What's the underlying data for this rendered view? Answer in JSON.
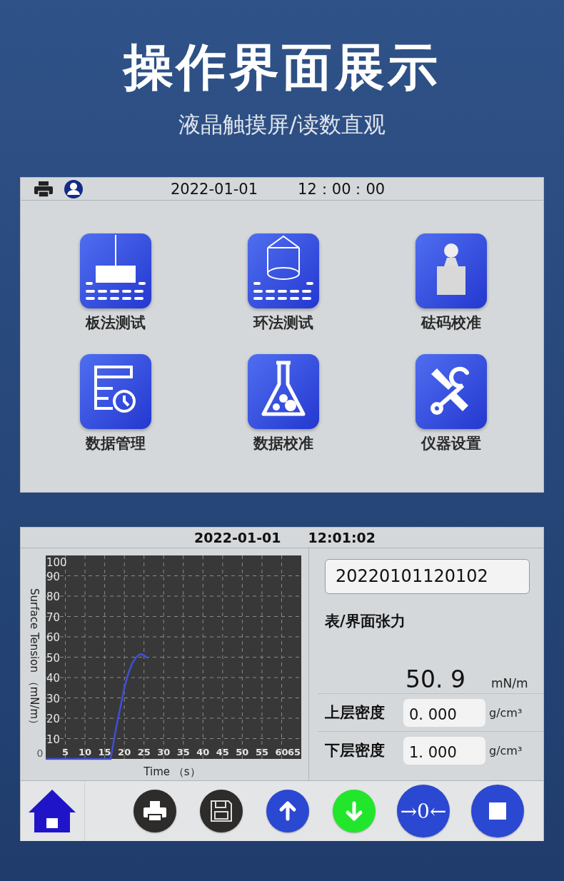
{
  "title": "操作界面展示",
  "subtitle": "液晶触摸屏/读数直观",
  "main_menu": {
    "status_bar": {
      "date": "2022-01-01",
      "time": "12：00：00"
    },
    "tiles": [
      {
        "kind": "plate",
        "label": "板法测试"
      },
      {
        "kind": "ring",
        "label": "环法测试"
      },
      {
        "kind": "weight",
        "label": "砝码校准"
      },
      {
        "kind": "records",
        "label": "数据管理"
      },
      {
        "kind": "flask",
        "label": "数据校准"
      },
      {
        "kind": "tools",
        "label": "仪器设置"
      }
    ]
  },
  "test_screen": {
    "header": {
      "date": "2022-01-01",
      "time": "12:01:02"
    },
    "chart_data": {
      "type": "line",
      "grid": true,
      "xlabel": "Time （s）",
      "ylabel": "Surface Tension （mN/m）",
      "xlim": [
        0,
        65
      ],
      "ylim": [
        0,
        100
      ],
      "xticks": [
        0,
        5,
        10,
        15,
        20,
        25,
        30,
        35,
        40,
        45,
        50,
        55,
        60,
        65
      ],
      "yticks": [
        10,
        20,
        30,
        40,
        50,
        60,
        70,
        80,
        90,
        100
      ],
      "x": [
        0,
        16.5,
        18,
        20,
        21,
        22,
        23,
        24,
        25,
        26
      ],
      "series": [
        {
          "color": "#3f4fd6",
          "values": [
            0,
            0,
            16,
            35,
            42,
            47,
            50,
            51.5,
            51,
            49.5
          ]
        }
      ]
    },
    "sample_id": "20220101120102",
    "result": {
      "label": "表/界面张力",
      "value": "50. 9",
      "unit": "mN/m"
    },
    "densities": [
      {
        "label": "上层密度",
        "value": "0. 000",
        "unit": "g/cm³"
      },
      {
        "label": "下层密度",
        "value": "1. 000",
        "unit": "g/cm³"
      }
    ],
    "toolbar": [
      {
        "kind": "home"
      },
      {
        "kind": "print",
        "color": "#2e2b2b"
      },
      {
        "kind": "save",
        "color": "#2e2b2b"
      },
      {
        "kind": "up",
        "color": "#2b48d2"
      },
      {
        "kind": "down",
        "color": "#22e62c"
      },
      {
        "kind": "zero",
        "color": "#2b48d2",
        "label": "→0←"
      },
      {
        "kind": "stop",
        "color": "#2b48d2"
      }
    ]
  }
}
